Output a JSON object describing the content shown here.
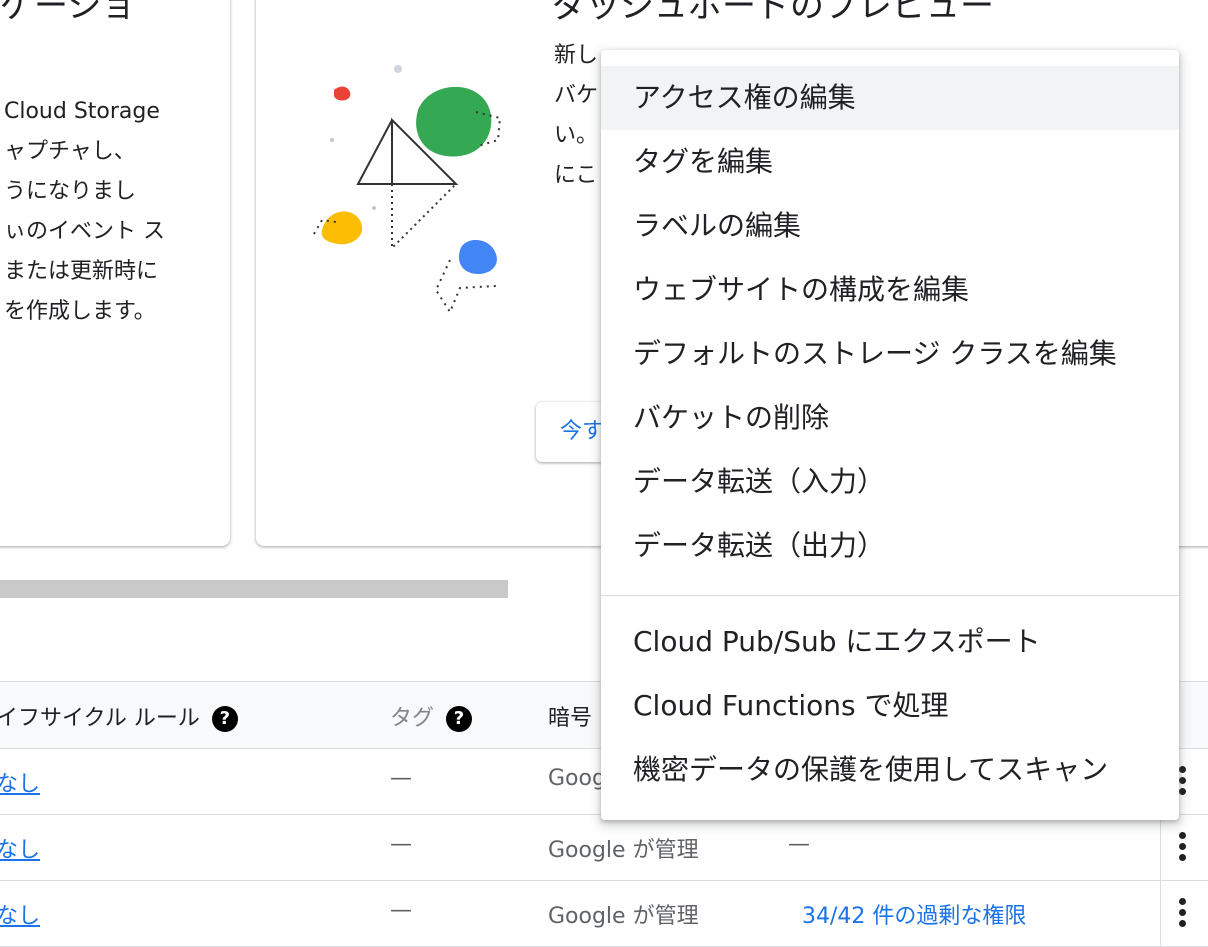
{
  "left_card": {
    "title": "ゲーショ",
    "lines": [
      "Cloud Storage",
      "ャプチャし、",
      "うになりまし",
      "ぃのイベント ス",
      "または更新時に",
      "を作成します。"
    ]
  },
  "mid_card": {
    "title": "ダッシュボードのプレビュー",
    "lines": [
      "新し",
      "バケ",
      "い。",
      "にこ"
    ],
    "try_button": "今す"
  },
  "table": {
    "headers": {
      "lifecycle": "イフサイクル ルール",
      "tags": "タグ",
      "encryption": "暗号"
    },
    "help_glyph": "?",
    "rows": [
      {
        "lifecycle": "なし",
        "tags": "—",
        "encryption": "Goog",
        "permissions": ""
      },
      {
        "lifecycle": "なし",
        "tags": "—",
        "encryption": "Google が管理",
        "permissions": "—"
      },
      {
        "lifecycle": "なし",
        "tags": "—",
        "encryption": "Google が管理",
        "permissions": "34/42 件の過剰な権限"
      }
    ]
  },
  "menu": {
    "group1": [
      "アクセス権の編集",
      "タグを編集",
      "ラベルの編集",
      "ウェブサイトの構成を編集",
      "デフォルトのストレージ クラスを編集",
      "バケットの削除",
      "データ転送（入力）",
      "データ転送（出力）"
    ],
    "group2": [
      "Cloud Pub/Sub にエクスポート",
      "Cloud Functions で処理",
      "機密データの保護を使用してスキャン"
    ]
  },
  "colors": {
    "link": "#1a73e8",
    "hover": "#f1f3f4",
    "red": "#ea4335",
    "green": "#34a853",
    "yellow": "#fbbc04",
    "blue": "#4285f4"
  }
}
